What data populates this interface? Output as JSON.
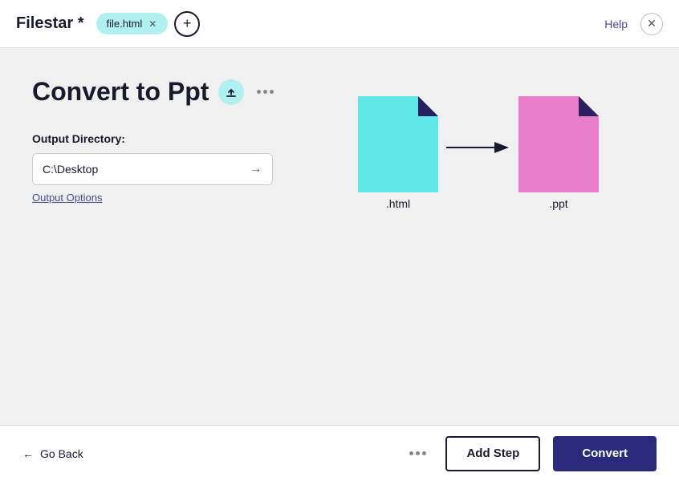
{
  "app": {
    "title": "Filestar *",
    "help_label": "Help"
  },
  "tabs": [
    {
      "label": "file.html",
      "id": "file-html-tab"
    }
  ],
  "tab_add_label": "+",
  "page": {
    "title": "Convert to Ppt"
  },
  "form": {
    "output_directory_label": "Output Directory:",
    "directory_value": "C:\\Desktop",
    "output_options_label": "Output Options"
  },
  "conversion": {
    "source_ext": ".html",
    "target_ext": ".ppt",
    "source_color": "#5ee8e8",
    "target_color": "#e87ec8",
    "corner_color": "#2a2060"
  },
  "bottom_bar": {
    "go_back_label": "Go Back",
    "add_step_label": "Add Step",
    "convert_label": "Convert"
  }
}
